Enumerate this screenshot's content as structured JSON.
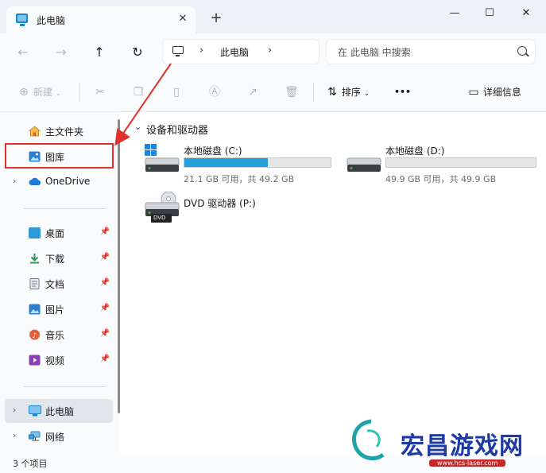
{
  "window": {
    "tab_title": "此电脑",
    "tab_close": "✕",
    "new_tab": "+",
    "minimize": "—",
    "maximize": "☐",
    "close": "✕"
  },
  "nav": {
    "back": "←",
    "forward": "→",
    "up": "↑",
    "refresh": "↻",
    "breadcrumb": "此电脑",
    "chev": "›",
    "search_placeholder": "在 此电脑 中搜索"
  },
  "toolbar": {
    "new_label": "新建",
    "sort_label": "排序",
    "more": "•••",
    "details_label": "详细信息"
  },
  "sidebar": {
    "home": "主文件夹",
    "gallery": "图库",
    "onedrive": "OneDrive",
    "quick": [
      {
        "label": "桌面",
        "icon": "desktop-icon",
        "color": "#2f9ad8"
      },
      {
        "label": "下载",
        "icon": "download-icon",
        "color": "#2a9d5a"
      },
      {
        "label": "文档",
        "icon": "document-icon",
        "color": "#6b7a8a"
      },
      {
        "label": "图片",
        "icon": "pictures-icon",
        "color": "#2f7fd0"
      },
      {
        "label": "音乐",
        "icon": "music-icon",
        "color": "#e0603a"
      },
      {
        "label": "视频",
        "icon": "video-icon",
        "color": "#8a3fb8"
      }
    ],
    "this_pc": "此电脑",
    "network": "网络"
  },
  "main": {
    "group_title": "设备和驱动器",
    "drives": [
      {
        "name": "本地磁盘 (C:)",
        "info": "21.1 GB 可用，共 49.2 GB",
        "used_fraction": 0.571,
        "bar_color": "#26a0da",
        "has_win_logo": true
      },
      {
        "name": "本地磁盘 (D:)",
        "info": "49.9 GB 可用，共 49.9 GB",
        "used_fraction": 0.0,
        "bar_color": "#26a0da",
        "has_win_logo": false
      }
    ],
    "dvd": {
      "name": "DVD 驱动器 (P:)",
      "badge": "DVD"
    }
  },
  "status": {
    "count": "3 个项目"
  },
  "watermark": {
    "text": "宏昌游戏网",
    "url": "www.hcs-laser.com"
  },
  "colors": {
    "accent": "#26a0da",
    "highlight_box": "#e0312a"
  }
}
